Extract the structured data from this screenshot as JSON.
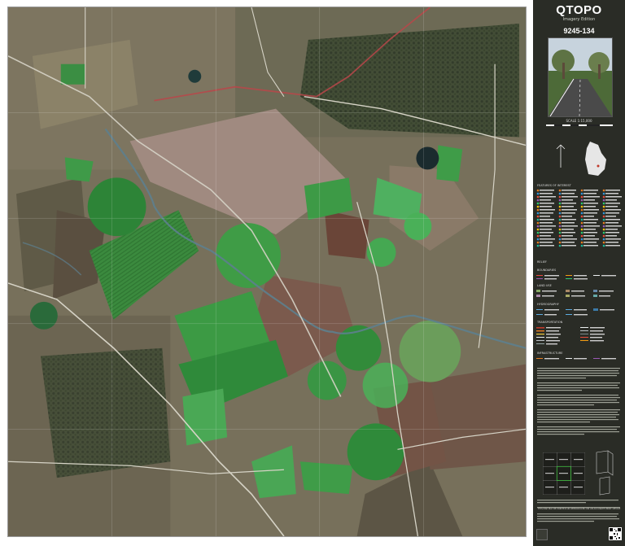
{
  "panel": {
    "brand": "QTOPO",
    "edition": "Imagery Edition",
    "sheet_id": "9245-134",
    "scale_label": "SCALE 1:15,000",
    "section_titles": [
      "FEATURES OF INTEREST",
      "RELIEF",
      "BOUNDARIES",
      "LAND USE",
      "HYDROGRAPHY",
      "TRANSPORTATION",
      "INFRASTRUCTURE"
    ],
    "notice": "THIS MAP MAY BE PRINTED OR REPRODUCED ON AN ACCURATE PRINT DEVICE"
  },
  "colors": {
    "panel_bg": "#2a2c26",
    "map_base": "#6f6a57",
    "field_green": "#2f8a3a",
    "field_bright": "#4fb060",
    "field_brown": "#6b4a3c",
    "road": "#cfcfcf",
    "creek_blue": "#6fa0c8"
  }
}
